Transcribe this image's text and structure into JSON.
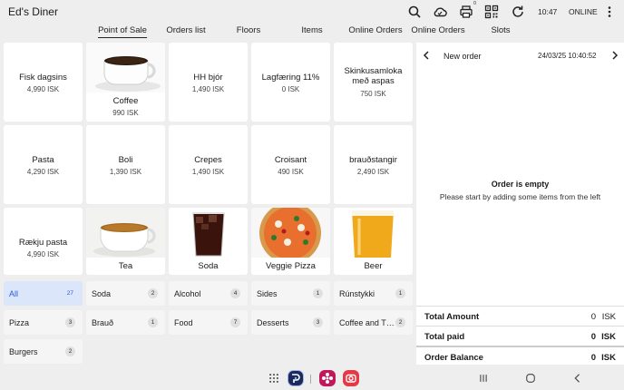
{
  "app": {
    "title": "Ed's Diner",
    "time": "10:47",
    "status": "ONLINE"
  },
  "top_icons": [
    "search-icon",
    "cloud-sync-icon",
    "printer-icon",
    "qr-code-icon",
    "refresh-icon",
    "more-vert-icon"
  ],
  "printer_badge": "0",
  "tabs": [
    {
      "label": "Point of Sale",
      "active": true
    },
    {
      "label": "Orders list"
    },
    {
      "label": "Floors"
    },
    {
      "label": "Items"
    },
    {
      "label": "Online Orders"
    },
    {
      "label": "Online Orders"
    },
    {
      "label": "Slots"
    }
  ],
  "products": [
    {
      "name": "Fisk dagsins",
      "price": "4,990 ISK"
    },
    {
      "name": "Coffee",
      "price": "990 ISK",
      "image": "coffee-cup"
    },
    {
      "name": "HH bjór",
      "price": "1,490 ISK"
    },
    {
      "name": "Lagfæring 11%",
      "price": "0 ISK"
    },
    {
      "name": "Skinkusamloka með aspas",
      "price": "750 ISK"
    },
    {
      "name": "Pasta",
      "price": "4,290 ISK"
    },
    {
      "name": "Boli",
      "price": "1,390 ISK"
    },
    {
      "name": "Crepes",
      "price": "1,490 ISK"
    },
    {
      "name": "Croisant",
      "price": "490 ISK"
    },
    {
      "name": "brauðstangir",
      "price": "2,490 ISK"
    },
    {
      "name": "Rækju pasta",
      "price": "4,990 ISK"
    },
    {
      "name": "Tea",
      "image": "tea-cup"
    },
    {
      "name": "Soda",
      "image": "soda-glass"
    },
    {
      "name": "Veggie Pizza",
      "image": "pizza"
    },
    {
      "name": "Beer",
      "image": "beer-glass"
    }
  ],
  "categories": [
    {
      "name": "All",
      "count": "27",
      "active": true
    },
    {
      "name": "Soda",
      "count": "2"
    },
    {
      "name": "Alcohol",
      "count": "4"
    },
    {
      "name": "Sides",
      "count": "1"
    },
    {
      "name": "Rúnstykki",
      "count": "1"
    },
    {
      "name": "Pizza",
      "count": "3"
    },
    {
      "name": "Brauð",
      "count": "1"
    },
    {
      "name": "Food",
      "count": "7"
    },
    {
      "name": "Desserts",
      "count": "3"
    },
    {
      "name": "Coffee and T…",
      "count": "2"
    },
    {
      "name": "Burgers",
      "count": "2"
    }
  ],
  "order": {
    "title": "New order",
    "date": "24/03/25 10:40:52",
    "empty_title": "Order is empty",
    "empty_subtitle": "Please start by adding some items from the left",
    "totals": [
      {
        "label": "Total Amount",
        "value": "0",
        "currency": "ISK"
      },
      {
        "label": "Total paid",
        "value": "0",
        "currency": "ISK"
      },
      {
        "label": "Order Balance",
        "value": "0",
        "currency": "ISK"
      }
    ]
  },
  "navbar": [
    "apps-grid-icon",
    "pos-app-icon",
    "flower-app-icon",
    "camera-app-icon",
    "recents-icon",
    "home-icon",
    "back-icon"
  ],
  "colors": {
    "accent": "#2b5bd7",
    "active_category_bg": "#dce6fa",
    "background": "#eeeeee"
  }
}
